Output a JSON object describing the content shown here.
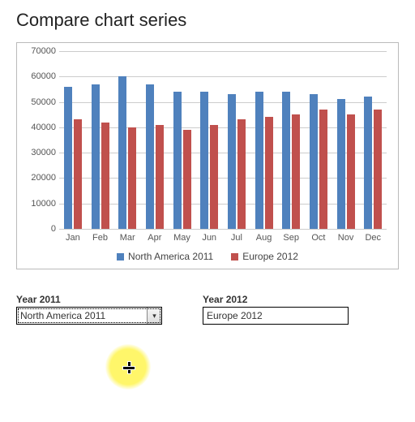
{
  "title": "Compare chart series",
  "chart_data": {
    "type": "bar",
    "categories": [
      "Jan",
      "Feb",
      "Mar",
      "Apr",
      "May",
      "Jun",
      "Jul",
      "Aug",
      "Sep",
      "Oct",
      "Nov",
      "Dec"
    ],
    "series": [
      {
        "name": "North America 2011",
        "color": "#4f81bd",
        "values": [
          56000,
          57000,
          60000,
          57000,
          54000,
          54000,
          53000,
          54000,
          54000,
          53000,
          51000,
          52000
        ]
      },
      {
        "name": "Europe 2012",
        "color": "#c0504d",
        "values": [
          43000,
          42000,
          40000,
          41000,
          39000,
          41000,
          43000,
          44000,
          45000,
          47000,
          45000,
          47000
        ]
      }
    ],
    "ylim": [
      0,
      70000
    ],
    "yticks": [
      0,
      10000,
      20000,
      30000,
      40000,
      50000,
      60000,
      70000
    ],
    "xlabel": "",
    "ylabel": ""
  },
  "controls": {
    "left": {
      "label": "Year 2011",
      "value": "North America 2011"
    },
    "right": {
      "label": "Year 2012",
      "value": "Europe 2012"
    }
  }
}
